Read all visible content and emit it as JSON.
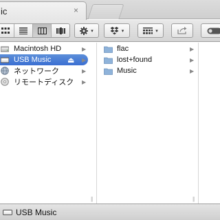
{
  "window": {
    "tab_title": "ic",
    "close_glyph": "×"
  },
  "toolbar": {
    "view_modes": [
      "icon-view",
      "list-view",
      "column-view",
      "cover-flow-view"
    ],
    "selected_view": "column-view",
    "action_caret": "▾",
    "dropbox_caret": "▾",
    "arrange_caret": "▾"
  },
  "sidebar": {
    "items": [
      {
        "label": "Macintosh HD",
        "icon": "hard-disk-icon",
        "chevron": "▶"
      },
      {
        "label": "USB Music",
        "icon": "usb-drive-icon",
        "eject": "⏏",
        "chevron": "▶",
        "selected": true
      },
      {
        "label": "ネットワーク",
        "icon": "network-globe-icon",
        "chevron": "▶"
      },
      {
        "label": "リモートディスク",
        "icon": "remote-disc-icon",
        "chevron": "▶"
      }
    ]
  },
  "folder_column": {
    "items": [
      {
        "label": "flac",
        "icon": "folder-icon",
        "chevron": "▶"
      },
      {
        "label": "lost+found",
        "icon": "folder-icon",
        "chevron": "▶"
      },
      {
        "label": "Music",
        "icon": "folder-icon",
        "chevron": "▶"
      }
    ]
  },
  "resize_handle_glyph": "||",
  "pathbar": {
    "label": "USB Music",
    "icon": "usb-drive-icon"
  },
  "colors": {
    "selection": "#3b6fd2",
    "folder": "#8fb3da"
  }
}
